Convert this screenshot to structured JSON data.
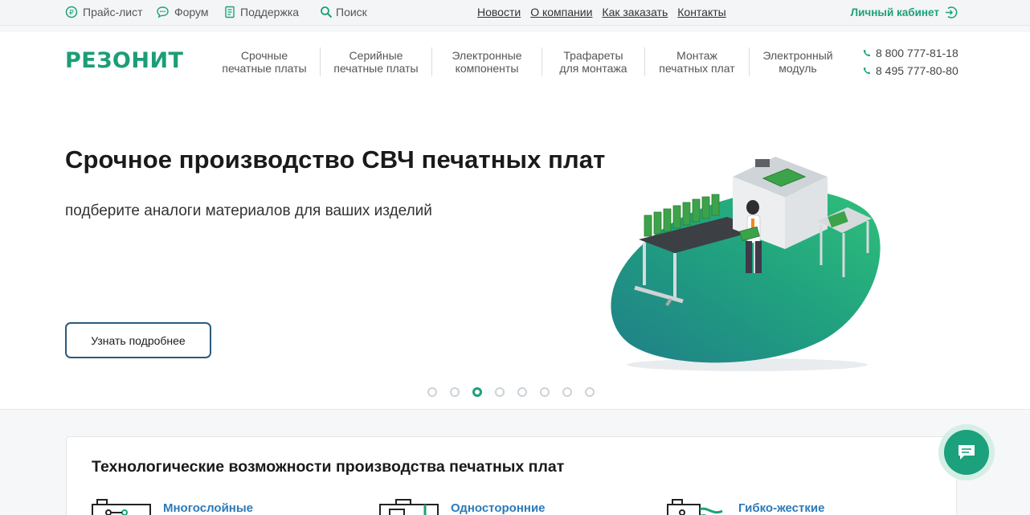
{
  "topbar": {
    "price": "Прайс-лист",
    "forum": "Форум",
    "support": "Поддержка",
    "search": "Поиск",
    "links": [
      "Новости",
      "О компании",
      "Как заказать",
      "Контакты"
    ],
    "cabinet": "Личный кабинет"
  },
  "header": {
    "logo": "РЕЗОНИТ",
    "nav": [
      {
        "l1": "Срочные",
        "l2": "печатные платы"
      },
      {
        "l1": "Серийные",
        "l2": "печатные платы"
      },
      {
        "l1": "Электронные",
        "l2": "компоненты"
      },
      {
        "l1": "Трафареты",
        "l2": "для монтажа"
      },
      {
        "l1": "Монтаж",
        "l2": "печатных плат"
      },
      {
        "l1": "Электронный",
        "l2": "модуль"
      }
    ],
    "phones": [
      "8 800 777-81-18",
      "8 495 777-80-80"
    ]
  },
  "hero": {
    "title": "Срочное производство СВЧ печатных плат",
    "subtitle": "подберите аналоги материалов для ваших изделий",
    "button": "Узнать подробнее",
    "slides_total": 8,
    "active_slide": 3
  },
  "capabilities": {
    "title": "Технологические возможности производства печатных плат",
    "items": [
      "Многослойные",
      "Односторонние",
      "Гибко-жесткие"
    ]
  },
  "colors": {
    "accent": "#1ba17b",
    "link": "#2d7ab8",
    "button_border": "#2c5a7c"
  }
}
